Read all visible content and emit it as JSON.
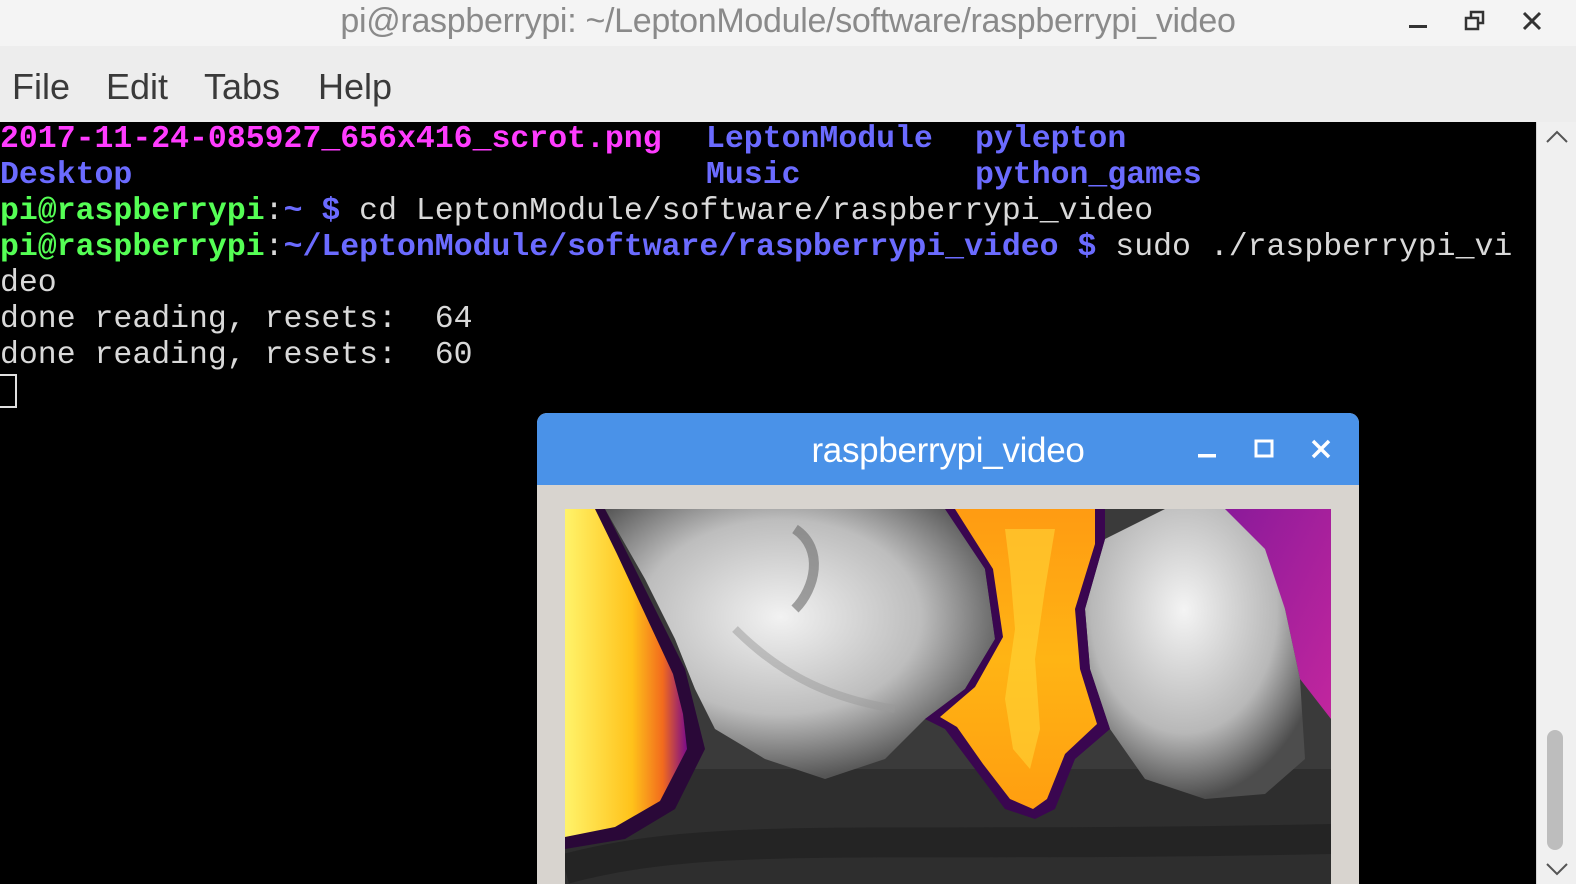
{
  "window": {
    "title": "pi@raspberrypi: ~/LeptonModule/software/raspberrypi_video",
    "controls": [
      "minimize-icon",
      "restore-icon",
      "close-icon"
    ]
  },
  "menu": {
    "file": "File",
    "edit": "Edit",
    "tabs": "Tabs",
    "help": "Help"
  },
  "terminal": {
    "ls": {
      "f1": "2017-11-24-085927_656x416_scrot.png",
      "f2": "LeptonModule",
      "f3": "pylepton",
      "f4": "Desktop",
      "f5": "Music",
      "f6": "python_games"
    },
    "cmd1": {
      "user": "pi@raspberrypi",
      "colon": ":",
      "path": "~ $",
      "command": " cd LeptonModule/software/raspberrypi_video"
    },
    "cmd2": {
      "user": "pi@raspberrypi",
      "colon": ":",
      "path": "~/LeptonModule/software/raspberrypi_video $",
      "command": " sudo ./raspberrypi_vi"
    },
    "wrap": "deo",
    "out1": "done reading, resets:  64",
    "out2": "done reading, resets:  60"
  },
  "video_window": {
    "title": "raspberrypi_video",
    "controls": [
      "minimize-icon",
      "maximize-icon",
      "close-icon"
    ],
    "content": "thermal camera image (grayscale with inferno-colored hot regions)"
  },
  "colors": {
    "file_png": "#ff3cff",
    "directory": "#6b6bff",
    "prompt_user": "#55ff55",
    "video_titlebar": "#4a92e8"
  }
}
